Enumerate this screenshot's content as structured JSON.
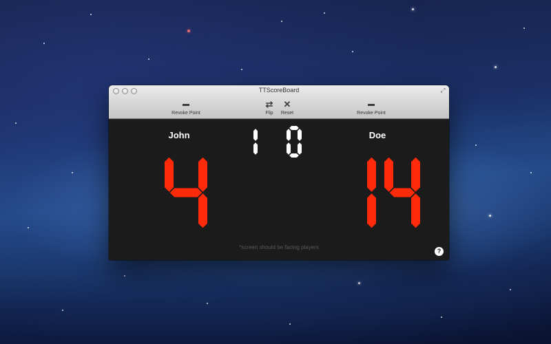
{
  "window": {
    "title": "TTScoreBoard"
  },
  "toolbar": {
    "left_revoke": {
      "icon": "minus-icon",
      "label": "Revoke Point"
    },
    "flip": {
      "icon": "flip-icon",
      "label": "Flip"
    },
    "reset": {
      "icon": "close-icon",
      "label": "Reset"
    },
    "right_revoke": {
      "icon": "minus-icon",
      "label": "Revoke Point"
    }
  },
  "players": {
    "left": {
      "name": "John",
      "score": "4"
    },
    "right": {
      "name": "Doe",
      "score": "14"
    }
  },
  "games": {
    "left": "1",
    "right": "0"
  },
  "footer": {
    "note": "*screen should be facing players",
    "help_label": "?"
  },
  "colors": {
    "score": "#ff2a0a",
    "games": "#ffffff",
    "background": "#1a1a1a"
  }
}
